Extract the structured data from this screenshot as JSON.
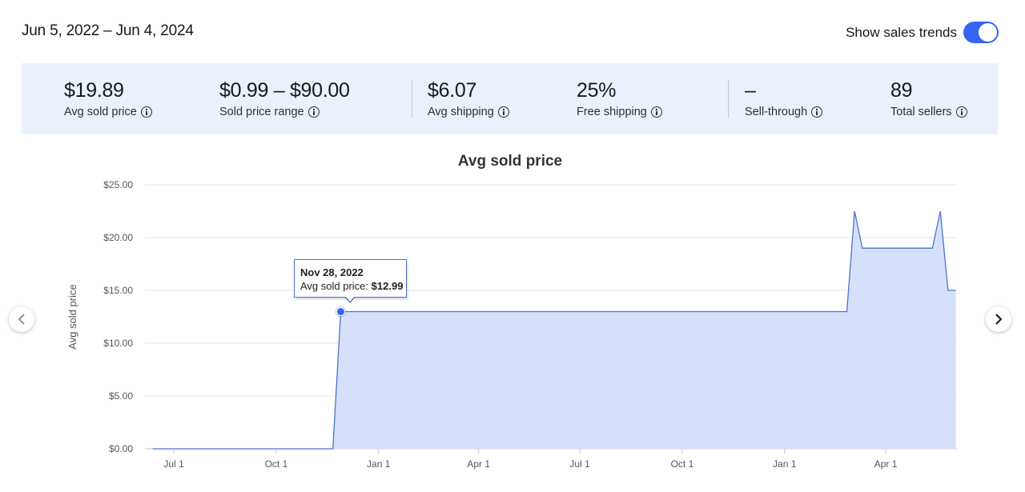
{
  "header": {
    "date_range": "Jun 5, 2022 – Jun 4, 2024",
    "toggle_label": "Show sales trends",
    "toggle_on": true
  },
  "stats": [
    {
      "value": "$19.89",
      "label": "Avg sold price"
    },
    {
      "value": "$0.99 – $90.00",
      "label": "Sold price range"
    },
    {
      "value": "$6.07",
      "label": "Avg shipping"
    },
    {
      "value": "25%",
      "label": "Free shipping"
    },
    {
      "value": "–",
      "label": "Sell-through"
    },
    {
      "value": "89",
      "label": "Total sellers"
    }
  ],
  "tooltip": {
    "date": "Nov 28, 2022",
    "label": "Avg sold price:",
    "value": "$12.99"
  },
  "colors": {
    "accent": "#3665f3",
    "stats_bg": "#e9f1fd",
    "area_fill": "#d6e0fb",
    "line": "#4a74d0"
  },
  "chart_data": {
    "type": "area",
    "title": "Avg sold price",
    "xlabel": "",
    "ylabel": "Avg sold price",
    "ylim": [
      0,
      25
    ],
    "yticks": [
      "$0.00",
      "$5.00",
      "$10.00",
      "$15.00",
      "$20.00",
      "$25.00"
    ],
    "xlim": [
      "2022-06-05",
      "2024-06-04"
    ],
    "xticks": [
      {
        "date": "2022-07-01",
        "label": "Jul 1"
      },
      {
        "date": "2022-10-01",
        "label": "Oct 1"
      },
      {
        "date": "2023-01-01",
        "label": "Jan 1"
      },
      {
        "date": "2023-04-01",
        "label": "Apr 1"
      },
      {
        "date": "2023-07-01",
        "label": "Jul 1"
      },
      {
        "date": "2023-10-01",
        "label": "Oct 1"
      },
      {
        "date": "2024-01-01",
        "label": "Jan 1"
      },
      {
        "date": "2024-04-01",
        "label": "Apr 1"
      }
    ],
    "grid": true,
    "series": [
      {
        "name": "Avg sold price",
        "points": [
          [
            "2022-06-12",
            0
          ],
          [
            "2022-11-21",
            0
          ],
          [
            "2022-11-28",
            12.99
          ],
          [
            "2024-02-26",
            12.99
          ],
          [
            "2024-03-04",
            22.5
          ],
          [
            "2024-03-11",
            19.0
          ],
          [
            "2024-05-13",
            19.0
          ],
          [
            "2024-05-20",
            22.5
          ],
          [
            "2024-05-27",
            15.0
          ],
          [
            "2024-06-03",
            15.0
          ]
        ]
      }
    ],
    "highlight": {
      "date": "2022-11-28",
      "value": 12.99
    }
  }
}
